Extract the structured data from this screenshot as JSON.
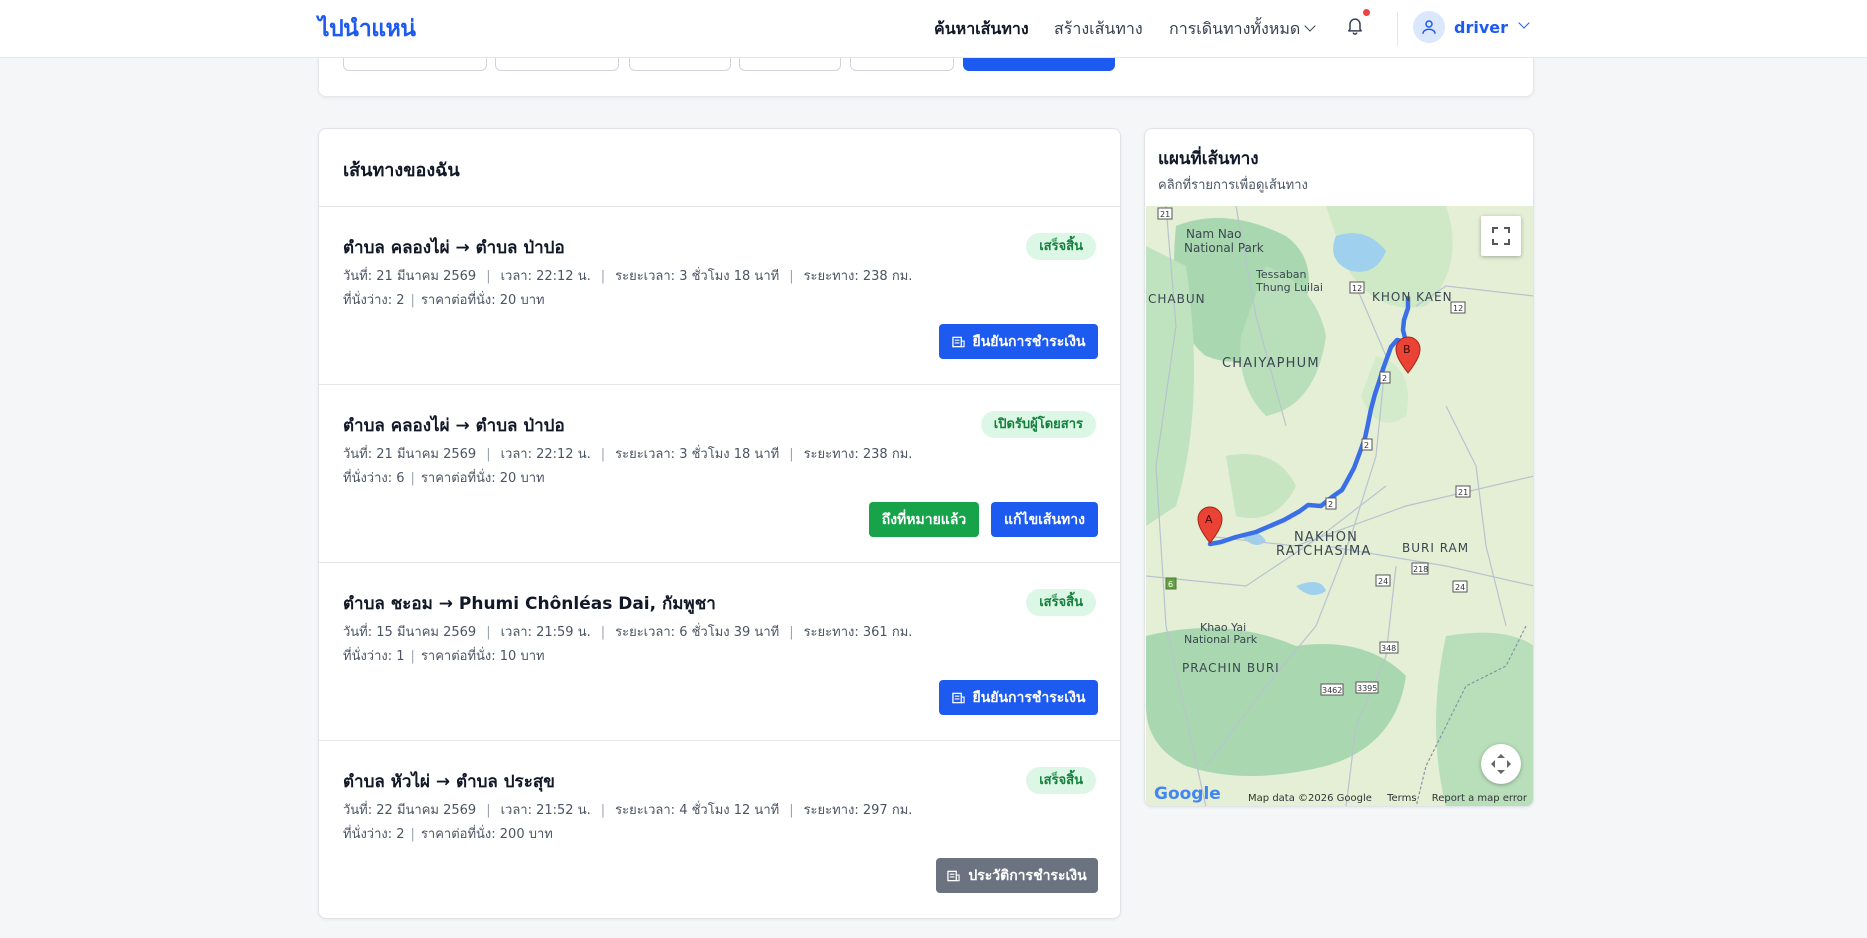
{
  "navbar": {
    "logo": "ไปนำแหน่",
    "links": [
      "ค้นหาเส้นทาง",
      "สร้างเส้นทาง",
      "การเดินทางทั้งหมด"
    ],
    "user_name": "driver"
  },
  "routes_panel": {
    "title": "เส้นทางของฉัน",
    "routes": [
      {
        "title": "ตำบล คลองไผ่ → ตำบล ป่าปอ",
        "status": "เสร็จสิ้น",
        "date": "วันที่: 21 มีนาคม 2569",
        "time": "เวลา: 22:12 น.",
        "duration": "ระยะเวลา: 3 ชั่วโมง 18 นาที",
        "distance": "ระยะทาง: 238 กม.",
        "seats": "ที่นั่งว่าง: 2",
        "price": "ราคาต่อที่นั่ง: 20 บาท",
        "button": "ยืนยันการชำระเงิน"
      },
      {
        "title": "ตำบล คลองไผ่ → ตำบล ป่าปอ",
        "status": "เปิดรับผู้โดยสาร",
        "date": "วันที่: 21 มีนาคม 2569",
        "time": "เวลา: 22:12 น.",
        "duration": "ระยะเวลา: 3 ชั่วโมง 18 นาที",
        "distance": "ระยะทาง: 238 กม.",
        "seats": "ที่นั่งว่าง: 6",
        "price": "ราคาต่อที่นั่ง: 20 บาท",
        "button_arrived": "ถึงที่หมายแล้ว",
        "button_edit": "แก้ไขเส้นทาง"
      },
      {
        "title": "ตำบล ชะอม → Phumi Chônléas Dai, กัมพูชา",
        "status": "เสร็จสิ้น",
        "date": "วันที่: 15 มีนาคม 2569",
        "time": "เวลา: 21:59 น.",
        "duration": "ระยะเวลา: 6 ชั่วโมง 39 นาที",
        "distance": "ระยะทาง: 361 กม.",
        "seats": "ที่นั่งว่าง: 1",
        "price": "ราคาต่อที่นั่ง: 10 บาท",
        "button": "ยืนยันการชำระเงิน"
      },
      {
        "title": "ตำบล หัวไผ่ → ตำบล ประสุข",
        "status": "เสร็จสิ้น",
        "date": "วันที่: 22 มีนาคม 2569",
        "time": "เวลา: 21:52 น.",
        "duration": "ระยะเวลา: 4 ชั่วโมง 12 นาที",
        "distance": "ระยะทาง: 297 กม.",
        "seats": "ที่นั่งว่าง: 2",
        "price": "ราคาต่อที่นั่ง: 200 บาท",
        "button": "ประวัติการชำระเงิน"
      }
    ]
  },
  "map_panel": {
    "title": "แผนที่เส้นทาง",
    "subtitle": "คลิกที่รายการเพื่อดูเส้นทาง",
    "labels": {
      "nam_nao": "Nam Nao",
      "national_park": "National Park",
      "tessaban": "Tessaban",
      "thung_luilai": "Thung Luilai",
      "chabun": "CHABUN",
      "khon_kaen": "KHON KAEN",
      "chaiyaphum": "CHAIYAPHUM",
      "nakhon": "NAKHON",
      "ratchasima": "RATCHASIMA",
      "buri_ram": "BURI RAM",
      "khao_yai": "Khao Yai",
      "prachin_buri": "PRACHIN BURI"
    },
    "marker_a": "A",
    "marker_b": "B",
    "footer": {
      "google": "Google",
      "map_data": "Map data ©2026 Google",
      "terms": "Terms",
      "report": "Report a map error"
    }
  },
  "colors": {
    "primary": "#1d5bf0",
    "success": "#16a34a",
    "badge_bg": "#dcf7e5",
    "route_line": "#3b6fe8",
    "marker": "#ea4335"
  }
}
